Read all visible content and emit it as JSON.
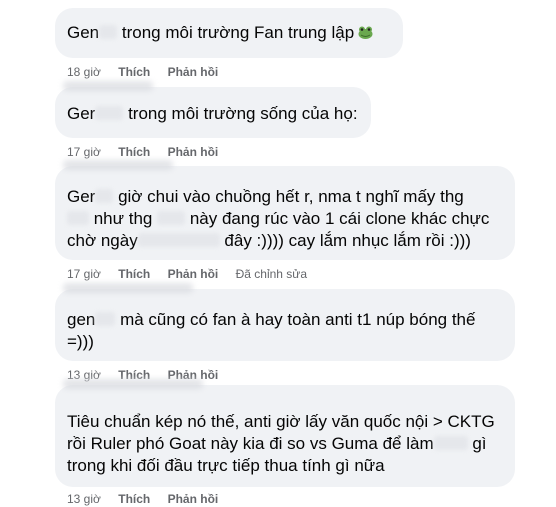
{
  "comments": [
    {
      "lines": [
        [
          "Gen",
          "",
          " trong môi trường Fan trung lập"
        ]
      ],
      "emoji": "frog",
      "time": "18 giờ",
      "like": "Thích",
      "reply": "Phản hồi",
      "edited": ""
    },
    {
      "lines": [
        [
          "Ger",
          "",
          " trong môi trường sống của họ:"
        ]
      ],
      "time": "17 giờ",
      "like": "Thích",
      "reply": "Phản hồi",
      "edited": ""
    },
    {
      "lines": [
        [
          "Ger",
          "",
          " giờ chui vào chuồng hết r, nma t nghĩ mấy thg"
        ],
        [
          "",
          "",
          " như thg ",
          "",
          " này đang rúc vào 1 cái clone khác chực"
        ],
        [
          "chờ ngày",
          "",
          " đây :)))) cay lắm nhục lắm rồi :)))"
        ]
      ],
      "time": "17 giờ",
      "like": "Thích",
      "reply": "Phản hồi",
      "edited": "Đã chỉnh sửa"
    },
    {
      "lines": [
        [
          "gen",
          "",
          " mà cũng có fan à hay toàn anti t1 núp bóng thế"
        ],
        [
          "=)))"
        ]
      ],
      "time": "13 giờ",
      "like": "Thích",
      "reply": "Phản hồi",
      "edited": ""
    },
    {
      "lines": [
        [
          "Tiêu chuẩn kép nó thế, anti giờ lấy văn quốc nội > CKTG"
        ],
        [
          "rồi Ruler phó Goat này kia đi so vs Guma để làm",
          "",
          " gì"
        ],
        [
          "trong khi đối đầu trực tiếp thua tính gì nữa"
        ]
      ],
      "time": "13 giờ",
      "like": "Thích",
      "reply": "Phản hồi",
      "edited": ""
    }
  ]
}
